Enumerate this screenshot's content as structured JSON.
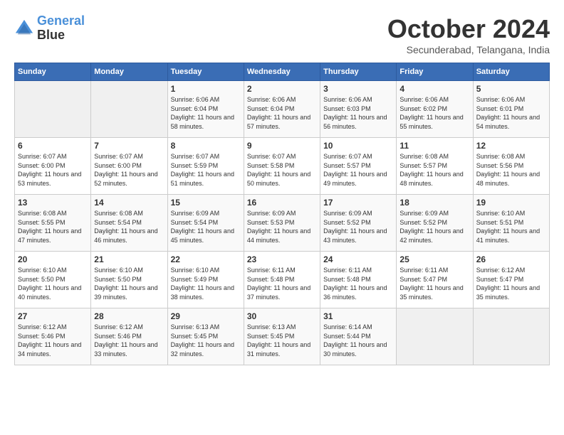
{
  "header": {
    "logo_line1": "General",
    "logo_line2": "Blue",
    "month_title": "October 2024",
    "location": "Secunderabad, Telangana, India"
  },
  "days_of_week": [
    "Sunday",
    "Monday",
    "Tuesday",
    "Wednesday",
    "Thursday",
    "Friday",
    "Saturday"
  ],
  "weeks": [
    [
      {
        "day": "",
        "sunrise": "",
        "sunset": "",
        "daylight": ""
      },
      {
        "day": "",
        "sunrise": "",
        "sunset": "",
        "daylight": ""
      },
      {
        "day": "1",
        "sunrise": "Sunrise: 6:06 AM",
        "sunset": "Sunset: 6:04 PM",
        "daylight": "Daylight: 11 hours and 58 minutes."
      },
      {
        "day": "2",
        "sunrise": "Sunrise: 6:06 AM",
        "sunset": "Sunset: 6:04 PM",
        "daylight": "Daylight: 11 hours and 57 minutes."
      },
      {
        "day": "3",
        "sunrise": "Sunrise: 6:06 AM",
        "sunset": "Sunset: 6:03 PM",
        "daylight": "Daylight: 11 hours and 56 minutes."
      },
      {
        "day": "4",
        "sunrise": "Sunrise: 6:06 AM",
        "sunset": "Sunset: 6:02 PM",
        "daylight": "Daylight: 11 hours and 55 minutes."
      },
      {
        "day": "5",
        "sunrise": "Sunrise: 6:06 AM",
        "sunset": "Sunset: 6:01 PM",
        "daylight": "Daylight: 11 hours and 54 minutes."
      }
    ],
    [
      {
        "day": "6",
        "sunrise": "Sunrise: 6:07 AM",
        "sunset": "Sunset: 6:00 PM",
        "daylight": "Daylight: 11 hours and 53 minutes."
      },
      {
        "day": "7",
        "sunrise": "Sunrise: 6:07 AM",
        "sunset": "Sunset: 6:00 PM",
        "daylight": "Daylight: 11 hours and 52 minutes."
      },
      {
        "day": "8",
        "sunrise": "Sunrise: 6:07 AM",
        "sunset": "Sunset: 5:59 PM",
        "daylight": "Daylight: 11 hours and 51 minutes."
      },
      {
        "day": "9",
        "sunrise": "Sunrise: 6:07 AM",
        "sunset": "Sunset: 5:58 PM",
        "daylight": "Daylight: 11 hours and 50 minutes."
      },
      {
        "day": "10",
        "sunrise": "Sunrise: 6:07 AM",
        "sunset": "Sunset: 5:57 PM",
        "daylight": "Daylight: 11 hours and 49 minutes."
      },
      {
        "day": "11",
        "sunrise": "Sunrise: 6:08 AM",
        "sunset": "Sunset: 5:57 PM",
        "daylight": "Daylight: 11 hours and 48 minutes."
      },
      {
        "day": "12",
        "sunrise": "Sunrise: 6:08 AM",
        "sunset": "Sunset: 5:56 PM",
        "daylight": "Daylight: 11 hours and 48 minutes."
      }
    ],
    [
      {
        "day": "13",
        "sunrise": "Sunrise: 6:08 AM",
        "sunset": "Sunset: 5:55 PM",
        "daylight": "Daylight: 11 hours and 47 minutes."
      },
      {
        "day": "14",
        "sunrise": "Sunrise: 6:08 AM",
        "sunset": "Sunset: 5:54 PM",
        "daylight": "Daylight: 11 hours and 46 minutes."
      },
      {
        "day": "15",
        "sunrise": "Sunrise: 6:09 AM",
        "sunset": "Sunset: 5:54 PM",
        "daylight": "Daylight: 11 hours and 45 minutes."
      },
      {
        "day": "16",
        "sunrise": "Sunrise: 6:09 AM",
        "sunset": "Sunset: 5:53 PM",
        "daylight": "Daylight: 11 hours and 44 minutes."
      },
      {
        "day": "17",
        "sunrise": "Sunrise: 6:09 AM",
        "sunset": "Sunset: 5:52 PM",
        "daylight": "Daylight: 11 hours and 43 minutes."
      },
      {
        "day": "18",
        "sunrise": "Sunrise: 6:09 AM",
        "sunset": "Sunset: 5:52 PM",
        "daylight": "Daylight: 11 hours and 42 minutes."
      },
      {
        "day": "19",
        "sunrise": "Sunrise: 6:10 AM",
        "sunset": "Sunset: 5:51 PM",
        "daylight": "Daylight: 11 hours and 41 minutes."
      }
    ],
    [
      {
        "day": "20",
        "sunrise": "Sunrise: 6:10 AM",
        "sunset": "Sunset: 5:50 PM",
        "daylight": "Daylight: 11 hours and 40 minutes."
      },
      {
        "day": "21",
        "sunrise": "Sunrise: 6:10 AM",
        "sunset": "Sunset: 5:50 PM",
        "daylight": "Daylight: 11 hours and 39 minutes."
      },
      {
        "day": "22",
        "sunrise": "Sunrise: 6:10 AM",
        "sunset": "Sunset: 5:49 PM",
        "daylight": "Daylight: 11 hours and 38 minutes."
      },
      {
        "day": "23",
        "sunrise": "Sunrise: 6:11 AM",
        "sunset": "Sunset: 5:48 PM",
        "daylight": "Daylight: 11 hours and 37 minutes."
      },
      {
        "day": "24",
        "sunrise": "Sunrise: 6:11 AM",
        "sunset": "Sunset: 5:48 PM",
        "daylight": "Daylight: 11 hours and 36 minutes."
      },
      {
        "day": "25",
        "sunrise": "Sunrise: 6:11 AM",
        "sunset": "Sunset: 5:47 PM",
        "daylight": "Daylight: 11 hours and 35 minutes."
      },
      {
        "day": "26",
        "sunrise": "Sunrise: 6:12 AM",
        "sunset": "Sunset: 5:47 PM",
        "daylight": "Daylight: 11 hours and 35 minutes."
      }
    ],
    [
      {
        "day": "27",
        "sunrise": "Sunrise: 6:12 AM",
        "sunset": "Sunset: 5:46 PM",
        "daylight": "Daylight: 11 hours and 34 minutes."
      },
      {
        "day": "28",
        "sunrise": "Sunrise: 6:12 AM",
        "sunset": "Sunset: 5:46 PM",
        "daylight": "Daylight: 11 hours and 33 minutes."
      },
      {
        "day": "29",
        "sunrise": "Sunrise: 6:13 AM",
        "sunset": "Sunset: 5:45 PM",
        "daylight": "Daylight: 11 hours and 32 minutes."
      },
      {
        "day": "30",
        "sunrise": "Sunrise: 6:13 AM",
        "sunset": "Sunset: 5:45 PM",
        "daylight": "Daylight: 11 hours and 31 minutes."
      },
      {
        "day": "31",
        "sunrise": "Sunrise: 6:14 AM",
        "sunset": "Sunset: 5:44 PM",
        "daylight": "Daylight: 11 hours and 30 minutes."
      },
      {
        "day": "",
        "sunrise": "",
        "sunset": "",
        "daylight": ""
      },
      {
        "day": "",
        "sunrise": "",
        "sunset": "",
        "daylight": ""
      }
    ]
  ]
}
